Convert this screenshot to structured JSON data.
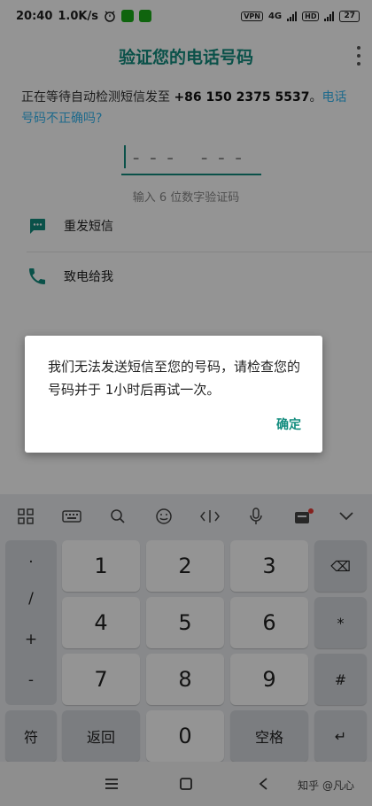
{
  "status_bar": {
    "time": "20:40",
    "speed": "1.0K/s",
    "vpn": "VPN",
    "net_4g": "4G",
    "hd": "HD",
    "battery": "27"
  },
  "header": {
    "title": "验证您的电话号码"
  },
  "instructions": {
    "text_prefix": "正在等待自动检测短信发至 ",
    "phone": "+86 150 2375 5537",
    "text_suffix": "。",
    "wrong_number_link": "电话号码不正确吗?"
  },
  "code_input": {
    "placeholder": "--- ---",
    "hint": "输入 6 位数字验证码"
  },
  "options": [
    {
      "label": "重发短信",
      "icon": "message-icon"
    },
    {
      "label": "致电给我",
      "icon": "phone-icon"
    }
  ],
  "dialog": {
    "message": "我们无法发送短信至您的号码，请检查您的号码并于 1小时后再试一次。",
    "ok_label": "确定"
  },
  "keyboard": {
    "toolbar": [
      "grid-icon",
      "keyboard-icon",
      "search-icon",
      "emoji-icon",
      "cursor-icon",
      "mic-icon",
      "clipboard-icon",
      "collapse-icon"
    ],
    "symbols": [
      ".",
      "/",
      "+",
      "-"
    ],
    "digits": [
      "1",
      "2",
      "3",
      "4",
      "5",
      "6",
      "7",
      "8",
      "9",
      "0"
    ],
    "right_keys": [
      "⌫",
      "*",
      "#"
    ],
    "bottom": {
      "symbols_label": "符",
      "back_label": "返回",
      "space_label": "空格",
      "enter": "↵"
    }
  },
  "watermark": "知乎 @凡心",
  "colors": {
    "accent": "#128c7e",
    "link": "#34b7f1"
  }
}
